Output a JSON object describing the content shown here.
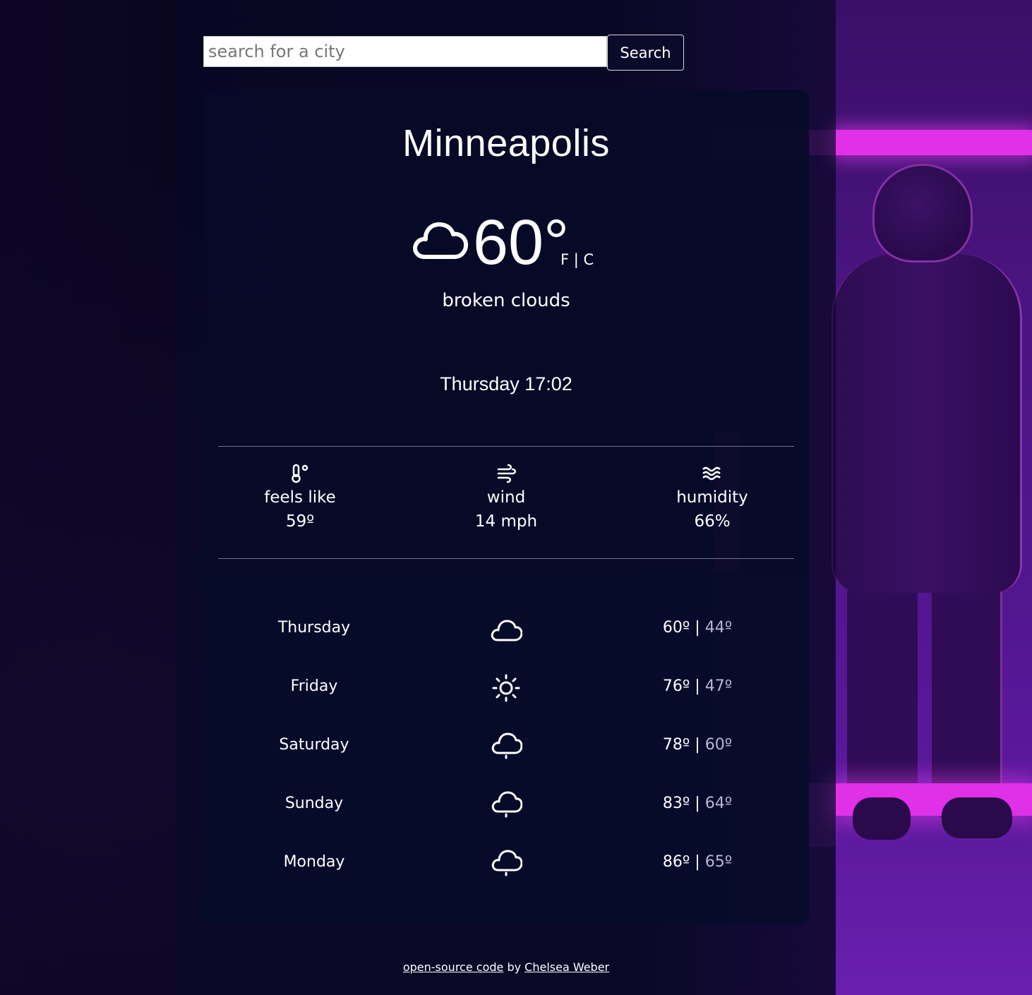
{
  "search": {
    "placeholder": "search for a city",
    "value": "",
    "button_label": "Search"
  },
  "current": {
    "city": "Minneapolis",
    "icon": "cloud-icon",
    "temperature": "60°",
    "unit_f": "F",
    "unit_separator": "|",
    "unit_c": "C",
    "description": "broken clouds",
    "datetime": "Thursday 17:02"
  },
  "stats": [
    {
      "icon": "thermometer-icon",
      "label": "feels like",
      "value": "59º"
    },
    {
      "icon": "wind-icon",
      "label": "wind",
      "value": "14 mph"
    },
    {
      "icon": "humidity-waves-icon",
      "label": "humidity",
      "value": "66%"
    }
  ],
  "forecast": [
    {
      "day": "Thursday",
      "icon": "cloud-icon",
      "high": "60º",
      "sep": " | ",
      "low": "44º"
    },
    {
      "day": "Friday",
      "icon": "sun-icon",
      "high": "76º",
      "sep": " | ",
      "low": "47º"
    },
    {
      "day": "Saturday",
      "icon": "cloud-drizzle-icon",
      "high": "78º",
      "sep": " | ",
      "low": "60º"
    },
    {
      "day": "Sunday",
      "icon": "cloud-drizzle-icon",
      "high": "83º",
      "sep": " | ",
      "low": "64º"
    },
    {
      "day": "Monday",
      "icon": "cloud-drizzle-icon",
      "high": "86º",
      "sep": " | ",
      "low": "65º"
    }
  ],
  "footer": {
    "link1": "open-source code",
    "middle": " by ",
    "link2": "Chelsea Weber"
  },
  "colors": {
    "background": "#0a0620",
    "card": "#060a28",
    "neon": "#e030e8",
    "low_temp": "#b9b6d4"
  }
}
